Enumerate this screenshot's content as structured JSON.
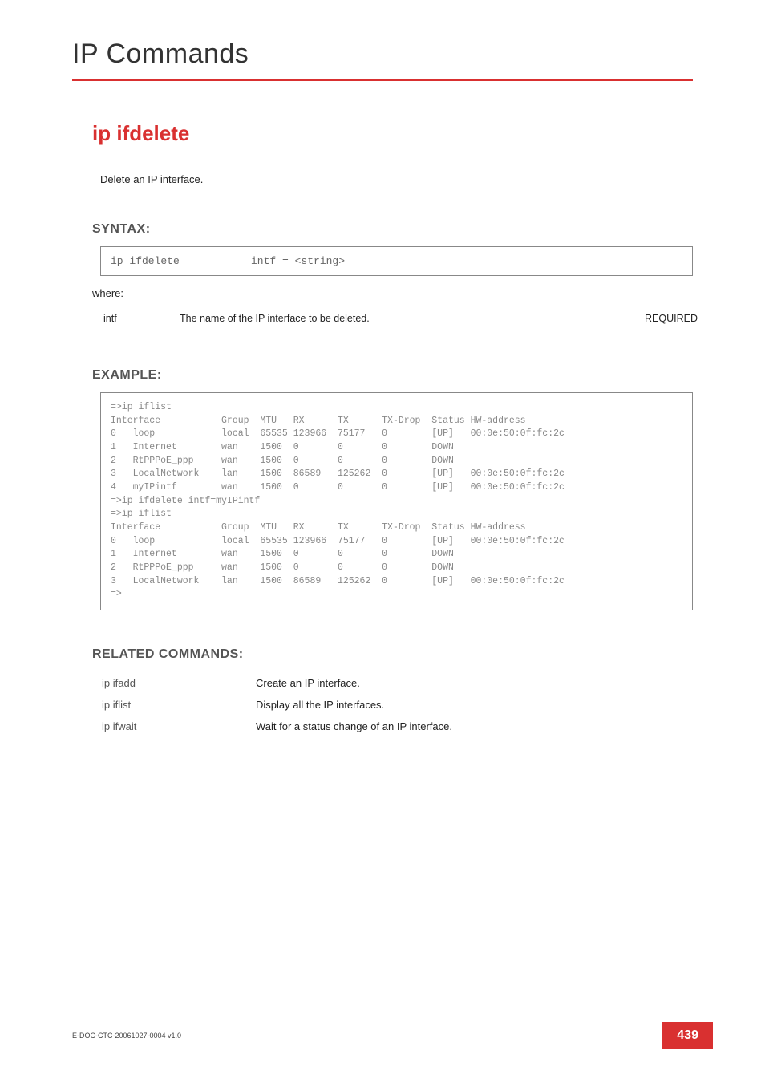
{
  "header": {
    "title": "IP Commands"
  },
  "cmd": {
    "name": "ip ifdelete",
    "description": "Delete an IP interface."
  },
  "syntax": {
    "label": "SYNTAX:",
    "command": "ip ifdelete",
    "args": "intf = <string>",
    "where": "where:",
    "params": [
      {
        "name": "intf",
        "desc": "The name of the IP interface to be deleted.",
        "req": "REQUIRED"
      }
    ]
  },
  "example": {
    "label": "EXAMPLE:",
    "text": "=>ip iflist\nInterface           Group  MTU   RX      TX      TX-Drop  Status HW-address\n0   loop            local  65535 123966  75177   0        [UP]   00:0e:50:0f:fc:2c\n1   Internet        wan    1500  0       0       0        DOWN\n2   RtPPPoE_ppp     wan    1500  0       0       0        DOWN\n3   LocalNetwork    lan    1500  86589   125262  0        [UP]   00:0e:50:0f:fc:2c\n4   myIPintf        wan    1500  0       0       0        [UP]   00:0e:50:0f:fc:2c\n=>ip ifdelete intf=myIPintf\n=>ip iflist\nInterface           Group  MTU   RX      TX      TX-Drop  Status HW-address\n0   loop            local  65535 123966  75177   0        [UP]   00:0e:50:0f:fc:2c\n1   Internet        wan    1500  0       0       0        DOWN\n2   RtPPPoE_ppp     wan    1500  0       0       0        DOWN\n3   LocalNetwork    lan    1500  86589   125262  0        [UP]   00:0e:50:0f:fc:2c\n=>"
  },
  "related": {
    "label": "RELATED COMMANDS:",
    "items": [
      {
        "cmd": "ip ifadd",
        "desc": "Create an IP interface."
      },
      {
        "cmd": "ip iflist",
        "desc": "Display all the IP interfaces."
      },
      {
        "cmd": "ip ifwait",
        "desc": "Wait for a status change of an IP interface."
      }
    ]
  },
  "footer": {
    "doc": "E-DOC-CTC-20061027-0004 v1.0",
    "page": "439"
  }
}
